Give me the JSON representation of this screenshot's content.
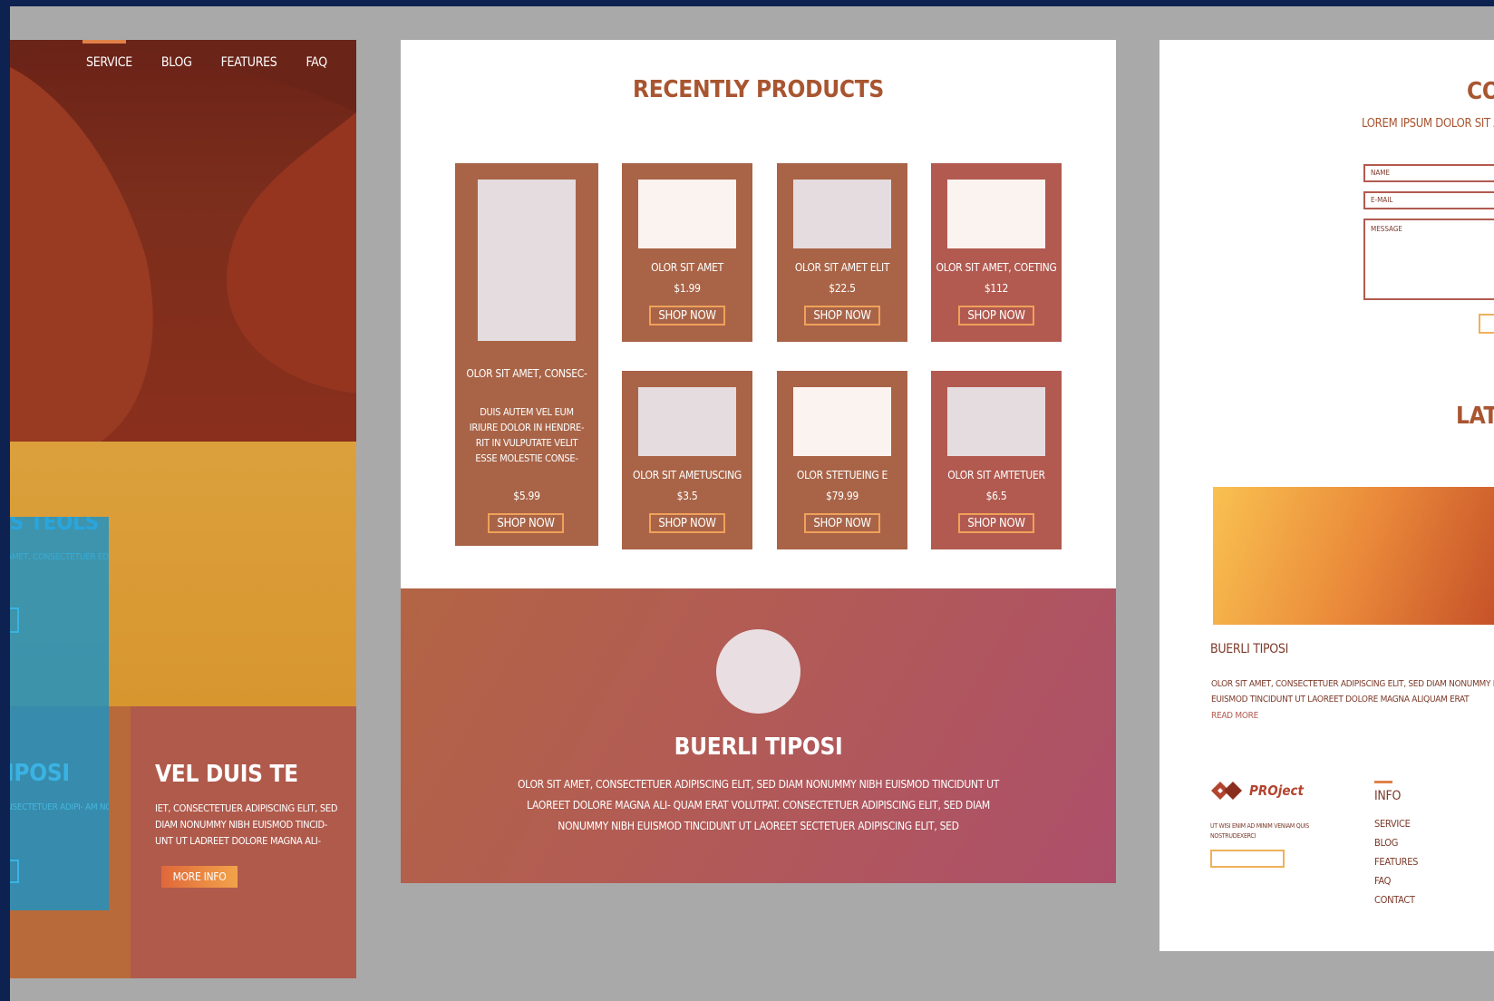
{
  "left": {
    "nav": [
      "SERVICE",
      "BLOG",
      "FEATURES",
      "FAQ"
    ],
    "card_title": "VEL DUIS TE",
    "card_text": "IET, CONSECTETUER ADIPISCING ELIT, SED DIAM NONUMMY NIBH EUISMOD TINCID- UNT UT LADREET DOLORE MAGNA ALI-",
    "card_button": "MORE INFO",
    "overlay_title": "JS TEOLS",
    "overlay_text": "AMET, CONSECTETUER ED DIAM NONUMMY IDUNT UT LAOREET",
    "overlay_title2": "IPOSI",
    "overlay_text2": "NSECTETUER ADIPI- AM NONUMMY NIBH T UT LAOREET"
  },
  "middle": {
    "title": "RECENTLY PRODUCTS",
    "featured": {
      "name": "OLOR SIT AMET, CONSEC-",
      "desc": "DUIS AUTEM VEL EUM IRIURE DOLOR IN HENDRE- RIT IN VULPUTATE VELIT ESSE MOLESTIE CONSE-",
      "price": "$5.99",
      "button": "SHOP NOW"
    },
    "products": [
      {
        "name": "OLOR SIT AMET",
        "price": "$1.99",
        "button": "SHOP NOW"
      },
      {
        "name": "OLOR SIT AMET ELIT",
        "price": "$22.5",
        "button": "SHOP NOW"
      },
      {
        "name": "OLOR SIT AMET, COETING",
        "price": "$112",
        "button": "SHOP NOW"
      },
      {
        "name": "OLOR SIT AMETUSCING",
        "price": "$3.5",
        "button": "SHOP NOW"
      },
      {
        "name": "OLOR STETUEING E",
        "price": "$79.99",
        "button": "SHOP NOW"
      },
      {
        "name": "OLOR SIT AMTETUER",
        "price": "$6.5",
        "button": "SHOP NOW"
      }
    ],
    "testimonial": {
      "name": "BUERLI TIPOSI",
      "text": "OLOR SIT AMET, CONSECTETUER ADIPISCING ELIT, SED DIAM NONUMMY NIBH EUISMOD TINCIDUNT UT LAOREET DOLORE MAGNA ALI- QUAM ERAT VOLUTPAT. CONSECTETUER ADIPISCING ELIT, SED DIAM NONUMMY NIBH EUISMOD TINCIDUNT UT LAOREET SECTETUER ADIPISCING ELIT, SED"
    }
  },
  "right": {
    "contact_title": "COI",
    "contact_sub": "LOREM IPSUM DOLOR SIT AI",
    "fields": {
      "name": "NAME",
      "email": "E-MAIL",
      "message": "MESSAGE"
    },
    "latest_title": "LATI",
    "blog_title": "BUERLI TIPOSI",
    "blog_text_1": "OLOR SIT AMET, CONSECTETUER ADIPISCING ELIT, SED DIAM NONUMMY NIBH",
    "blog_text_2": "EUISMOD TINCIDUNT UT LAOREET DOLORE MAGNA ALIQUAM ERAT",
    "read_more": "READ MORE",
    "logo": "PROject",
    "footer_text": "UT WISI ENIM AD MINIM VENIAM QUIS NOSTRUDEXERCI",
    "info_title": "INFO",
    "info_links": [
      "SERVICE",
      "BLOG",
      "FEATURES",
      "FAQ",
      "CONTACT"
    ]
  },
  "colors": {
    "frame": "#0d2250",
    "backdrop": "#a9a9a9",
    "brand_brown": "#a85530",
    "card_brown": "#a96447",
    "card_red": "#b25a50",
    "accent_orange": "#f0a15a",
    "overlay_blue": "#1b92c6"
  }
}
